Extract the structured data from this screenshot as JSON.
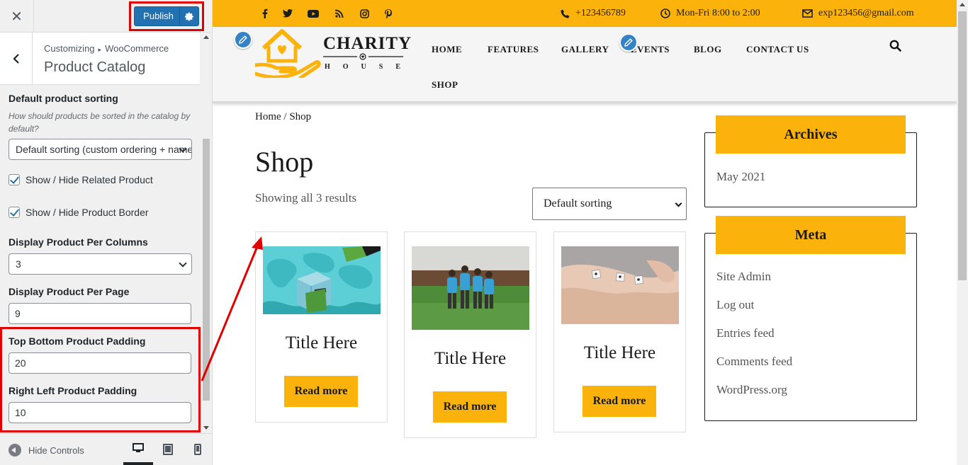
{
  "customizer": {
    "close_icon": "close-icon",
    "publish_label": "Publish",
    "breadcrumb_root": "Customizing",
    "breadcrumb_sep": "▸",
    "breadcrumb_section": "WooCommerce",
    "panel_title": "Product Catalog",
    "sorting": {
      "title": "Default product sorting",
      "description": "How should products be sorted in the catalog by default?",
      "value": "Default sorting (custom ordering + name)"
    },
    "related_label": "Show / Hide Related Product",
    "border_label": "Show / Hide Product Border",
    "columns": {
      "title": "Display Product Per Columns",
      "value": "3"
    },
    "per_page": {
      "title": "Display Product Per Page",
      "value": "9"
    },
    "tb_padding": {
      "title": "Top Bottom Product Padding",
      "value": "20"
    },
    "rl_padding": {
      "title": "Right Left Product Padding",
      "value": "10"
    },
    "hide_controls": "Hide Controls",
    "highlight_color": "#e00000"
  },
  "site": {
    "accent_color": "#fbb20b",
    "phone": "+123456789",
    "hours": "Mon-Fri 8:00 to 2:00",
    "email": "exp123456@gmail.com",
    "logo_brand": "CHARITY",
    "logo_sub": "HOUSE",
    "nav": [
      "HOME",
      "FEATURES",
      "GALLERY",
      "EVENTS",
      "BLOG",
      "CONTACT US",
      "SHOP"
    ],
    "breadcrumb": "Home / Shop",
    "page_title": "Shop",
    "results": "Showing all 3 results",
    "sort_value": "Default sorting",
    "products": [
      {
        "title": "Title Here",
        "button": "Read more"
      },
      {
        "title": "Title Here",
        "button": "Read more"
      },
      {
        "title": "Title Here",
        "button": "Read more"
      }
    ],
    "archives": {
      "title": "Archives",
      "items": [
        "May 2021"
      ]
    },
    "meta": {
      "title": "Meta",
      "items": [
        "Site Admin",
        "Log out",
        "Entries feed",
        "Comments feed",
        "WordPress.org"
      ]
    }
  }
}
